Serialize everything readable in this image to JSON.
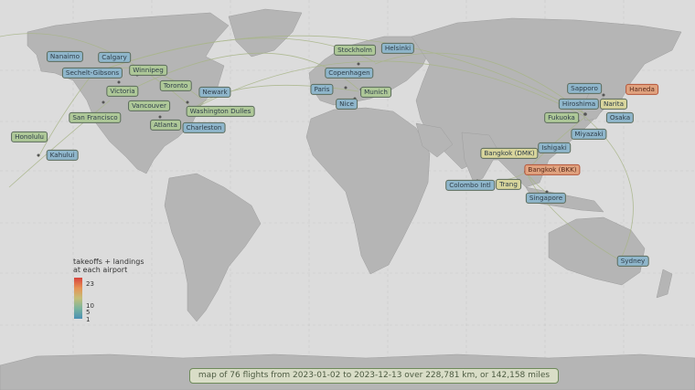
{
  "colors": {
    "ocean": "#dcdcdc",
    "land": "#b5b5b5",
    "route": "#a8b588",
    "scale_low": "#4a8fb4",
    "scale_mid": "#c4bf79",
    "scale_high": "#d7423c"
  },
  "legend": {
    "title_line1": "takeoffs + landings",
    "title_line2": "at each airport",
    "tick_23": "23",
    "tick_10": "10",
    "tick_5": "5",
    "tick_1": "1"
  },
  "caption": "map of 76 flights from 2023-01-02 to 2023-12-13 over 228,781 km, or 142,158 miles",
  "airports": [
    {
      "name": "Nanaimo",
      "level": "low"
    },
    {
      "name": "Calgary",
      "level": "low"
    },
    {
      "name": "Sechelt-Gibsons",
      "level": "low"
    },
    {
      "name": "Winnipeg",
      "level": "mid"
    },
    {
      "name": "Victoria",
      "level": "mid"
    },
    {
      "name": "Toronto",
      "level": "mid"
    },
    {
      "name": "Newark",
      "level": "low"
    },
    {
      "name": "Vancouver",
      "level": "mid"
    },
    {
      "name": "Washington Dulles",
      "level": "mid"
    },
    {
      "name": "San Francisco",
      "level": "mid"
    },
    {
      "name": "Atlanta",
      "level": "mid"
    },
    {
      "name": "Charleston",
      "level": "low"
    },
    {
      "name": "Honolulu",
      "level": "mid"
    },
    {
      "name": "Kahului",
      "level": "low"
    },
    {
      "name": "Stockholm",
      "level": "mid"
    },
    {
      "name": "Helsinki",
      "level": "low"
    },
    {
      "name": "Copenhagen",
      "level": "low"
    },
    {
      "name": "Paris",
      "level": "low"
    },
    {
      "name": "Munich",
      "level": "mid"
    },
    {
      "name": "Nice",
      "level": "low"
    },
    {
      "name": "Sapporo",
      "level": "low"
    },
    {
      "name": "Haneda",
      "level": "high"
    },
    {
      "name": "Hiroshima",
      "level": "low"
    },
    {
      "name": "Narita",
      "level": "midhigh"
    },
    {
      "name": "Fukuoka",
      "level": "mid"
    },
    {
      "name": "Osaka",
      "level": "low"
    },
    {
      "name": "Miyazaki",
      "level": "low"
    },
    {
      "name": "Ishigaki",
      "level": "low"
    },
    {
      "name": "Bangkok (DMK)",
      "level": "midhigh"
    },
    {
      "name": "Bangkok (BKK)",
      "level": "high"
    },
    {
      "name": "Colombo Intl",
      "level": "low"
    },
    {
      "name": "Trang",
      "level": "midhigh"
    },
    {
      "name": "Singapore",
      "level": "low"
    },
    {
      "name": "Sydney",
      "level": "low"
    }
  ]
}
